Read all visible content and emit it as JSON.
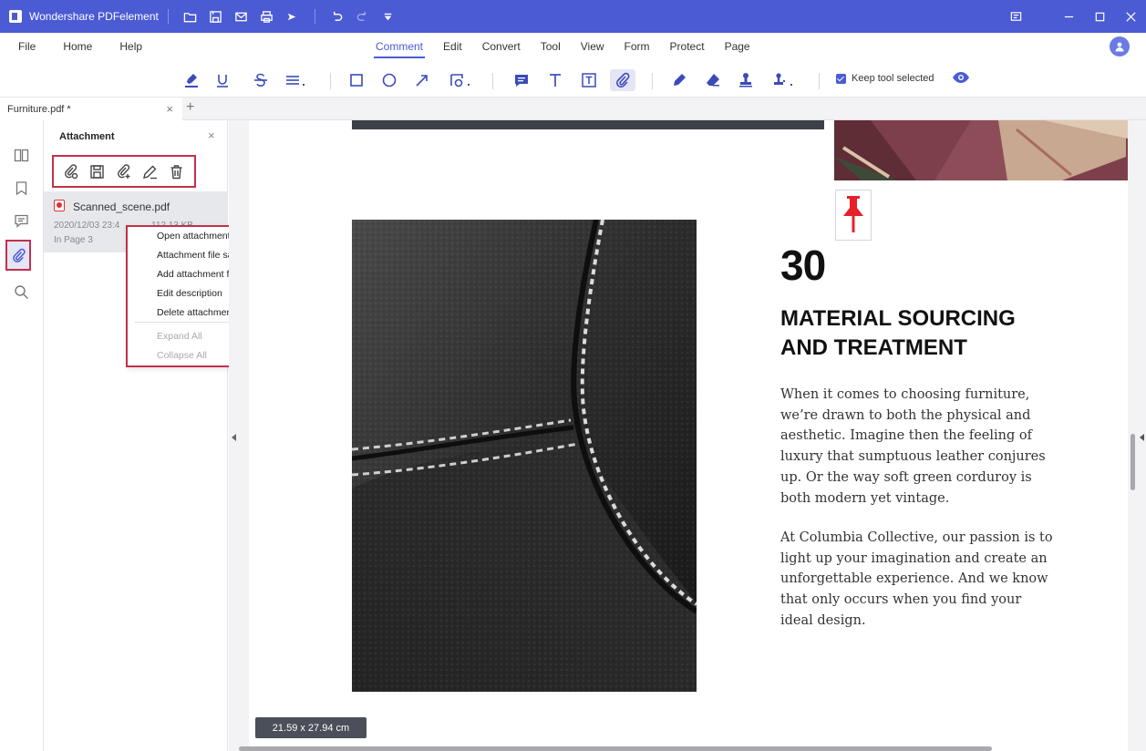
{
  "titlebar": {
    "app_name": "Wondershare PDFelement"
  },
  "menu": {
    "left": [
      "File",
      "Home",
      "Help"
    ],
    "center": [
      "Comment",
      "Edit",
      "Convert",
      "Tool",
      "View",
      "Form",
      "Protect",
      "Page"
    ],
    "active": "Comment"
  },
  "ribbon": {
    "keep_tool_label": "Keep tool selected"
  },
  "tab": {
    "filename": "Furniture.pdf *",
    "close_glyph": "×",
    "add_glyph": "+"
  },
  "panel": {
    "title": "Attachment",
    "close_glyph": "×",
    "item": {
      "name": "Scanned_scene.pdf",
      "date": "2020/12/03 23:4",
      "date_tail": "112.13 KB",
      "page": "In Page 3"
    }
  },
  "context_menu": {
    "items": [
      "Open attachment file",
      "Attachment file save as",
      "Add attachment file",
      "Edit description",
      "Delete attachment"
    ],
    "disabled_items": [
      "Expand All",
      "Collapse All"
    ]
  },
  "document": {
    "number": "30",
    "heading_line1": "MATERIAL SOURCING",
    "heading_line2": "AND TREATMENT",
    "para1_lines": [
      "When it comes to choosing furniture,",
      "we’re drawn to both the physical and",
      "aesthetic. Imagine then the feeling of",
      "luxury that sumptuous leather conjures",
      "up. Or the way soft green corduroy is",
      "both modern yet vintage."
    ],
    "para2_lines": [
      "At Columbia Collective, our passion is to",
      "light up your imagination and create an",
      "unforgettable experience. And we know",
      "that only occurs when you find your",
      "ideal design."
    ]
  },
  "status": {
    "page_size": "21.59 x 27.94 cm"
  },
  "colors": {
    "brand": "#4a5bd4",
    "highlight_border": "#c3304a",
    "pin": "#e8202a"
  }
}
